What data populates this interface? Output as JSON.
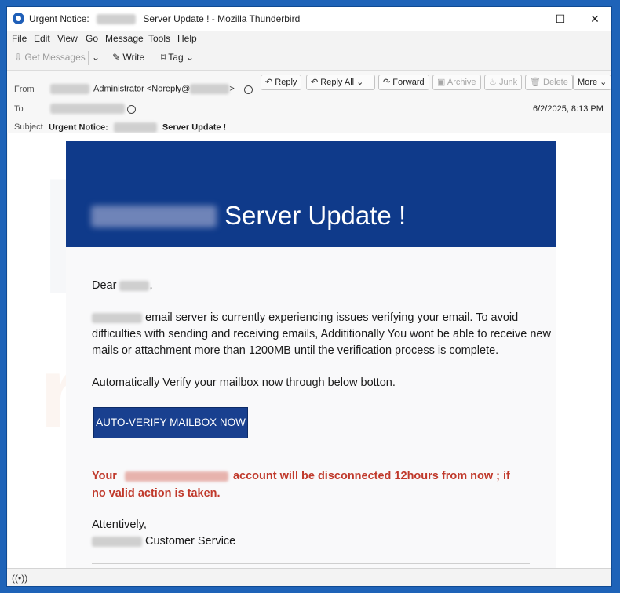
{
  "window": {
    "title_prefix": "Urgent Notice:",
    "title_suffix": "Server Update ! - Mozilla Thunderbird",
    "controls": {
      "minimize": "—",
      "maximize": "☐",
      "close": "✕"
    }
  },
  "menu": [
    "File",
    "Edit",
    "View",
    "Go",
    "Message",
    "Tools",
    "Help"
  ],
  "toolbar": {
    "get_messages": "Get Messages",
    "write": "Write",
    "tag": "Tag"
  },
  "header": {
    "from_label": "From",
    "from_name": "Administrator",
    "from_email_start": "<Noreply@",
    "from_email_end": ">",
    "to_label": "To",
    "subject_label": "Subject",
    "subject_prefix": "Urgent Notice:",
    "subject_suffix": "Server Update !",
    "date": "6/2/2025, 8:13 PM",
    "buttons": {
      "reply": "Reply",
      "reply_all": "Reply All",
      "forward": "Forward",
      "archive": "Archive",
      "junk": "Junk",
      "delete": "Delete",
      "more": "More"
    }
  },
  "email": {
    "banner_title": "Server Update !",
    "greeting_start": "Dear",
    "greeting_end": ",",
    "para1_line1": "email server is currently experiencing issues verifying your email. To avoid",
    "para1_line2": "difficulties with sending and receiving emails, Addititionally You wont be able to receive new",
    "para1_line3": "mails or attachment more than 1200MB until the verification process is complete.",
    "para2": "Automatically Verify your mailbox now through below botton.",
    "cta": "AUTO-VERIFY MAILBOX NOW",
    "warning_start": "Your",
    "warning_mid": "account will be disconnected  12hours from now ; if",
    "warning_line2": "no valid action is taken.",
    "signoff": "Attentively,",
    "signature": "Customer Service"
  },
  "watermark": {
    "top": "PC",
    "bottom": "risk.com"
  },
  "colors": {
    "banner": "#0f3a8a",
    "button": "#19408f",
    "warning": "#c0392b",
    "frame": "#1e63b8"
  }
}
